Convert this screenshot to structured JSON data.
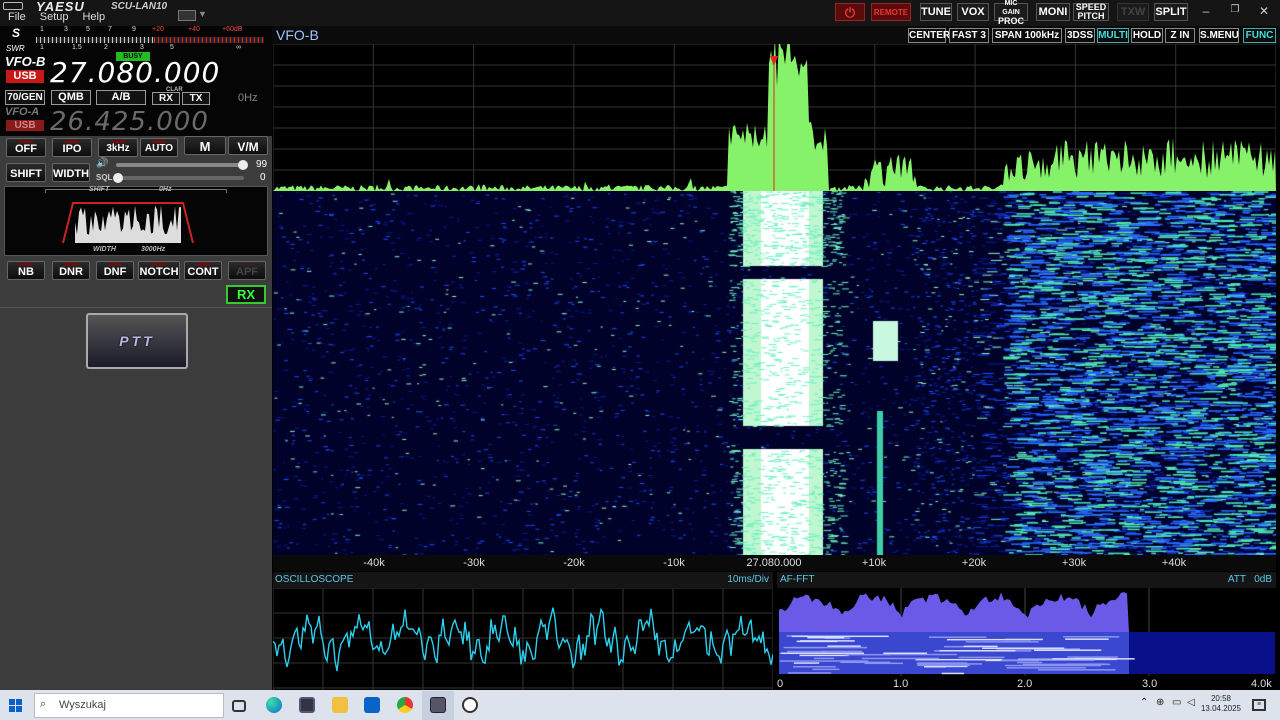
{
  "app": {
    "brand": "YAESU",
    "model": "SCU-LAN10"
  },
  "menu": [
    "File",
    "Setup",
    "Help"
  ],
  "topbar": {
    "power_label": "⏻",
    "remote_label": "REMOTE",
    "tune": "TUNE",
    "vox": "VOX",
    "micgain_top": "MIC GAIN",
    "micgain_bottom": "PROC",
    "moni": "MONI",
    "speed_top": "SPEED",
    "speed_bottom": "PITCH",
    "txw": "TXW",
    "split": "SPLIT",
    "minimize": "–",
    "restore": "❐",
    "close": "✕"
  },
  "meter": {
    "s_label": "S",
    "swr_label": "SWR",
    "s_scale": [
      "1",
      "3",
      "5",
      "7",
      "9",
      "+20",
      "+40",
      "+60dB"
    ],
    "swr_scale": [
      "1",
      "1.5",
      "2",
      "3",
      "5",
      "∞"
    ]
  },
  "vfo_b": {
    "label": "VFO-B",
    "mode": "USB",
    "frequency": "27.080.000",
    "busy": "BUSY"
  },
  "vfo_a": {
    "label": "VFO-A",
    "mode": "USB",
    "frequency": "26.425.000"
  },
  "row1": {
    "gen": "70/GEN",
    "qmb": "QMB",
    "ab": "A/B",
    "clar": "CLAR",
    "rx": "RX",
    "tx": "TX",
    "offset": "0Hz"
  },
  "row2": {
    "off": "OFF",
    "ipo": "IPO",
    "bw": "3kHz",
    "auto": "AUTO",
    "m": "M",
    "vm": "V/M"
  },
  "row3": {
    "shift": "SHIFT",
    "width": "WIDTH",
    "sql_label": "SQL",
    "af_value": "99",
    "sql_value": "0"
  },
  "filter": {
    "shift_label": "SHIFT",
    "shift_value": "0Hz",
    "width_label": "WIDTH",
    "width_value": "3000Hz"
  },
  "dsp": {
    "nb": "NB",
    "dnr": "DNR",
    "dnf": "DNF",
    "notch": "NOTCH",
    "cont": "CONT",
    "apf": "APF"
  },
  "rx_indicator": "RX",
  "ptt_label": "PTT",
  "scope": {
    "vfo": "VFO-B",
    "center": "CENTER",
    "fast": "FAST 3",
    "span": "SPAN  100kHz",
    "dss": "3DSS",
    "multi": "MULTI",
    "hold": "HOLD",
    "zin": "Z IN",
    "smenu": "S.MENU",
    "func": "FUNC"
  },
  "axis_ticks": [
    "-40k",
    "-30k",
    "-20k",
    "-10k",
    "27.080.000",
    "+10k",
    "+20k",
    "+30k",
    "+40k"
  ],
  "osc": {
    "title": "OSCILLOSCOPE",
    "div": "10ms/Div"
  },
  "afft": {
    "title": "AF-FFT",
    "att": "ATT",
    "att_value": "0dB",
    "ticks": [
      "0",
      "1.0",
      "2.0",
      "3.0",
      "4.0k"
    ]
  },
  "taskbar": {
    "search_placeholder": "Wyszukaj",
    "time": "20:58",
    "date": "13.04.2025"
  },
  "colors": {
    "spectrum": "#86f26a",
    "waterfall_bg": "#00022a",
    "osc_trace": "#2ad0ee",
    "afft_fill": "#6b5ae8",
    "freq_text": "#ffffff",
    "vfo_a_text": "#6a6a6a",
    "mode_bg": "#c81818"
  },
  "icons": [
    "windows-start-icon",
    "search-icon",
    "task-view-icon",
    "edge-icon",
    "store-icon",
    "explorer-icon",
    "outlook-icon",
    "chrome-icon",
    "radio-app-icon",
    "wifi-icon",
    "volume-icon",
    "notification-icon"
  ]
}
